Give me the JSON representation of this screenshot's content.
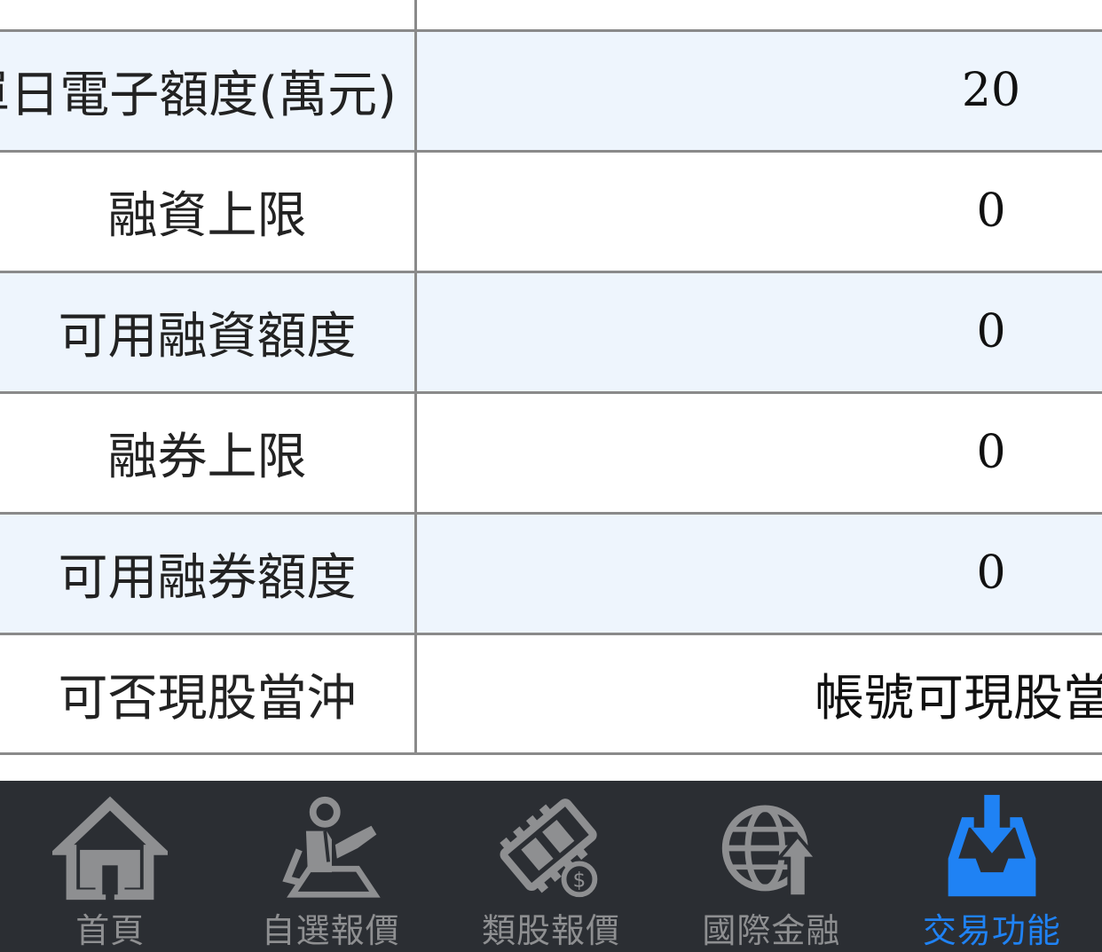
{
  "table": {
    "rows": [
      {
        "label": "",
        "value": ""
      },
      {
        "label": "單日電子額度(萬元)",
        "value": "20"
      },
      {
        "label": "融資上限",
        "value": "0"
      },
      {
        "label": "可用融資額度",
        "value": "0"
      },
      {
        "label": "融券上限",
        "value": "0"
      },
      {
        "label": "可用融券額度",
        "value": "0"
      },
      {
        "label": "可否現股當沖",
        "value": "帳號可現股當沖"
      }
    ]
  },
  "tabbar": {
    "items": [
      {
        "label": "首頁",
        "icon": "home-icon",
        "active": false
      },
      {
        "label": "自選報價",
        "icon": "person-desk-icon",
        "active": false
      },
      {
        "label": "類股報價",
        "icon": "film-coin-icon",
        "active": false
      },
      {
        "label": "國際金融",
        "icon": "globe-up-icon",
        "active": false
      },
      {
        "label": "交易功能",
        "icon": "download-tray-icon",
        "active": true
      }
    ],
    "colors": {
      "background": "#2b2e33",
      "inactive": "#8e8f91",
      "active": "#1f82f4"
    }
  }
}
